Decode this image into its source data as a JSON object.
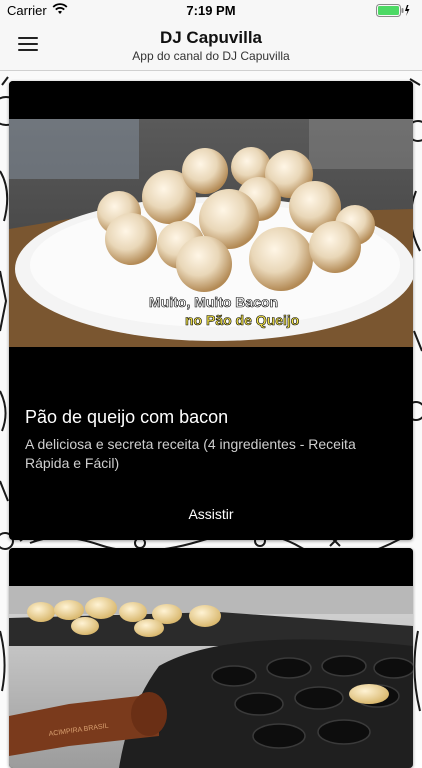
{
  "status_bar": {
    "carrier": "Carrier",
    "time": "7:19 PM",
    "wifi_icon": "wifi-icon",
    "battery_icon": "battery-charging-icon",
    "battery_color": "#4cd964"
  },
  "nav": {
    "title": "DJ Capuvilla",
    "subtitle": "App do canal do DJ Capuvilla",
    "menu_icon": "hamburger-menu-icon"
  },
  "cards": [
    {
      "title": "Pão de queijo com bacon",
      "description": "A deliciosa e secreta receita (4 ingredientes - Receita Rápida e Fácil)",
      "thumbnail_caption_line1": "Muito, Muito Bacon",
      "thumbnail_caption_line2": "no Pão de Queijo",
      "action_label": "Assistir"
    },
    {
      "thumbnail_stamp": "ACIMPIRA BRASIL"
    }
  ],
  "colors": {
    "card_bg": "#000000",
    "nav_bg": "#f7f7f7",
    "caption_highlight": "#ff2a1f",
    "caption_yellow": "#f2e34a"
  }
}
